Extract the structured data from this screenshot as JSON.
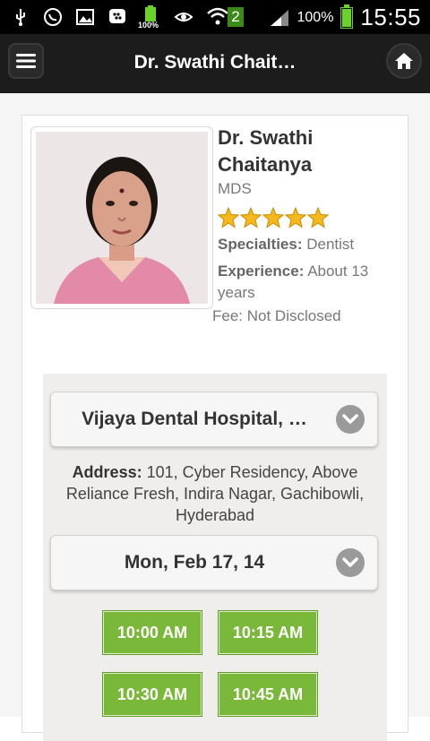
{
  "status_bar": {
    "battery_percent": "100%",
    "time": "15:55",
    "notification_battery_label": "100%",
    "sim_badge": "2"
  },
  "app_bar": {
    "title": "Dr. Swathi Chait…"
  },
  "doctor": {
    "name": "Dr. Swathi Chaitanya",
    "degree": "MDS",
    "rating": 5,
    "rating_max": 5,
    "specialties_label": "Specialties:",
    "specialties_value": "Dentist",
    "experience_label": "Experience:",
    "experience_value": "About 13 years",
    "fee_text": "Fee: Not Disclosed"
  },
  "clinic": {
    "selected": "Vijaya Dental Hospital, …",
    "address_label": "Address:",
    "address_value": "101, Cyber Residency, Above Reliance Fresh, Indira Nagar, Gachibowli, Hyderabad"
  },
  "date": {
    "selected": "Mon, Feb 17, 14"
  },
  "slots": [
    "10:00 AM",
    "10:15 AM",
    "10:30 AM",
    "10:45 AM"
  ],
  "colors": {
    "slot_green": "#7ab839",
    "star_gold": "#f6b81a",
    "app_bar": "#1c1c1c"
  }
}
